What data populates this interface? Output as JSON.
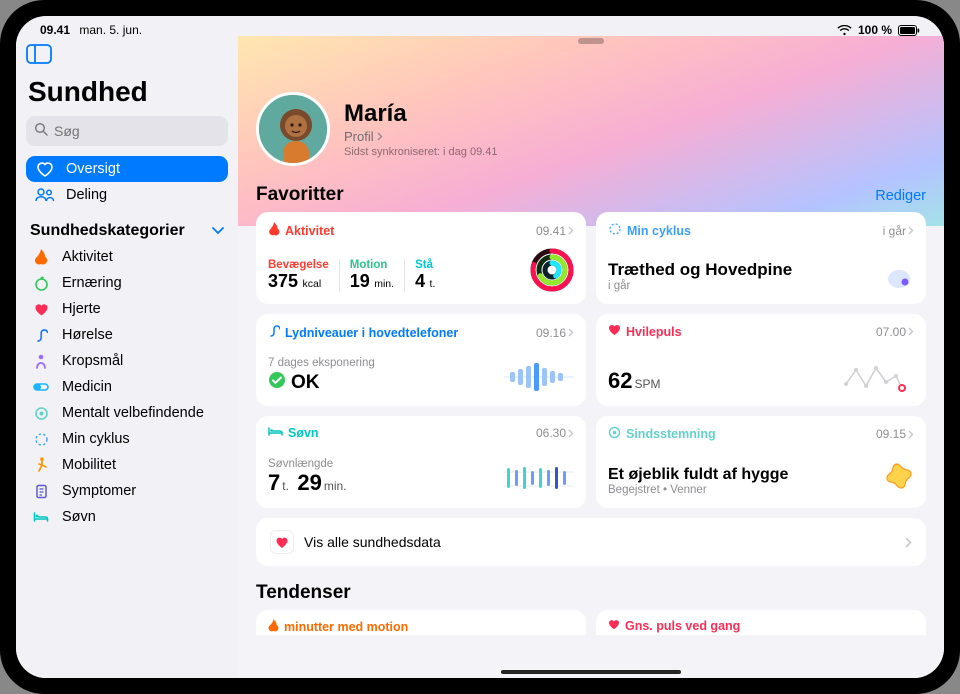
{
  "status": {
    "time": "09.41",
    "date": "man. 5. jun.",
    "battery": "100 %"
  },
  "sidebar": {
    "app_title": "Sundhed",
    "search_placeholder": "Søg",
    "nav": [
      {
        "label": "Oversigt"
      },
      {
        "label": "Deling"
      }
    ],
    "categories_title": "Sundhedskategorier",
    "categories": [
      {
        "label": "Aktivitet",
        "color": "#ff6a00"
      },
      {
        "label": "Ernæring",
        "color": "#34c759"
      },
      {
        "label": "Hjerte",
        "color": "#ff2d55"
      },
      {
        "label": "Hørelse",
        "color": "#1e7bff"
      },
      {
        "label": "Kropsmål",
        "color": "#9a6bff"
      },
      {
        "label": "Medicin",
        "color": "#19b6ff"
      },
      {
        "label": "Mentalt velbefindende",
        "color": "#64d2c9"
      },
      {
        "label": "Min cyklus",
        "color": "#3aa0ff"
      },
      {
        "label": "Mobilitet",
        "color": "#ff9500"
      },
      {
        "label": "Symptomer",
        "color": "#5f5bd4"
      },
      {
        "label": "Søvn",
        "color": "#00c7be"
      }
    ]
  },
  "profile": {
    "name": "María",
    "profile_link": "Profil",
    "last_sync": "Sidst synkroniseret: i dag 09.41"
  },
  "favorites": {
    "title": "Favoritter",
    "edit": "Rediger",
    "activity": {
      "title": "Aktivitet",
      "time": "09.41",
      "move_label": "Bevægelse",
      "move_value": "375",
      "move_unit": "kcal",
      "exercise_label": "Motion",
      "exercise_value": "19",
      "exercise_unit": "min.",
      "stand_label": "Stå",
      "stand_value": "4",
      "stand_unit": "t."
    },
    "cycle": {
      "title": "Min cyklus",
      "time": "i går",
      "main": "Træthed og Hovedpine",
      "sub": "i går"
    },
    "audio": {
      "title": "Lydniveauer i hovedtelefoner",
      "time": "09.16",
      "sub": "7 dages eksponering",
      "status": "OK"
    },
    "resting": {
      "title": "Hvilepuls",
      "time": "07.00",
      "value": "62",
      "unit": "SPM"
    },
    "sleep": {
      "title": "Søvn",
      "time": "06.30",
      "sub": "Søvnlængde",
      "hours": "7",
      "hours_unit": "t.",
      "mins": "29",
      "mins_unit": "min."
    },
    "mood": {
      "title": "Sindsstemning",
      "time": "09.15",
      "main": "Et øjeblik fuldt af hygge",
      "sub": "Begejstret • Venner"
    },
    "all_data": "Vis alle sundhedsdata"
  },
  "trends": {
    "title": "Tendenser",
    "left": "minutter med motion",
    "right": "Gns. puls ved gang"
  }
}
